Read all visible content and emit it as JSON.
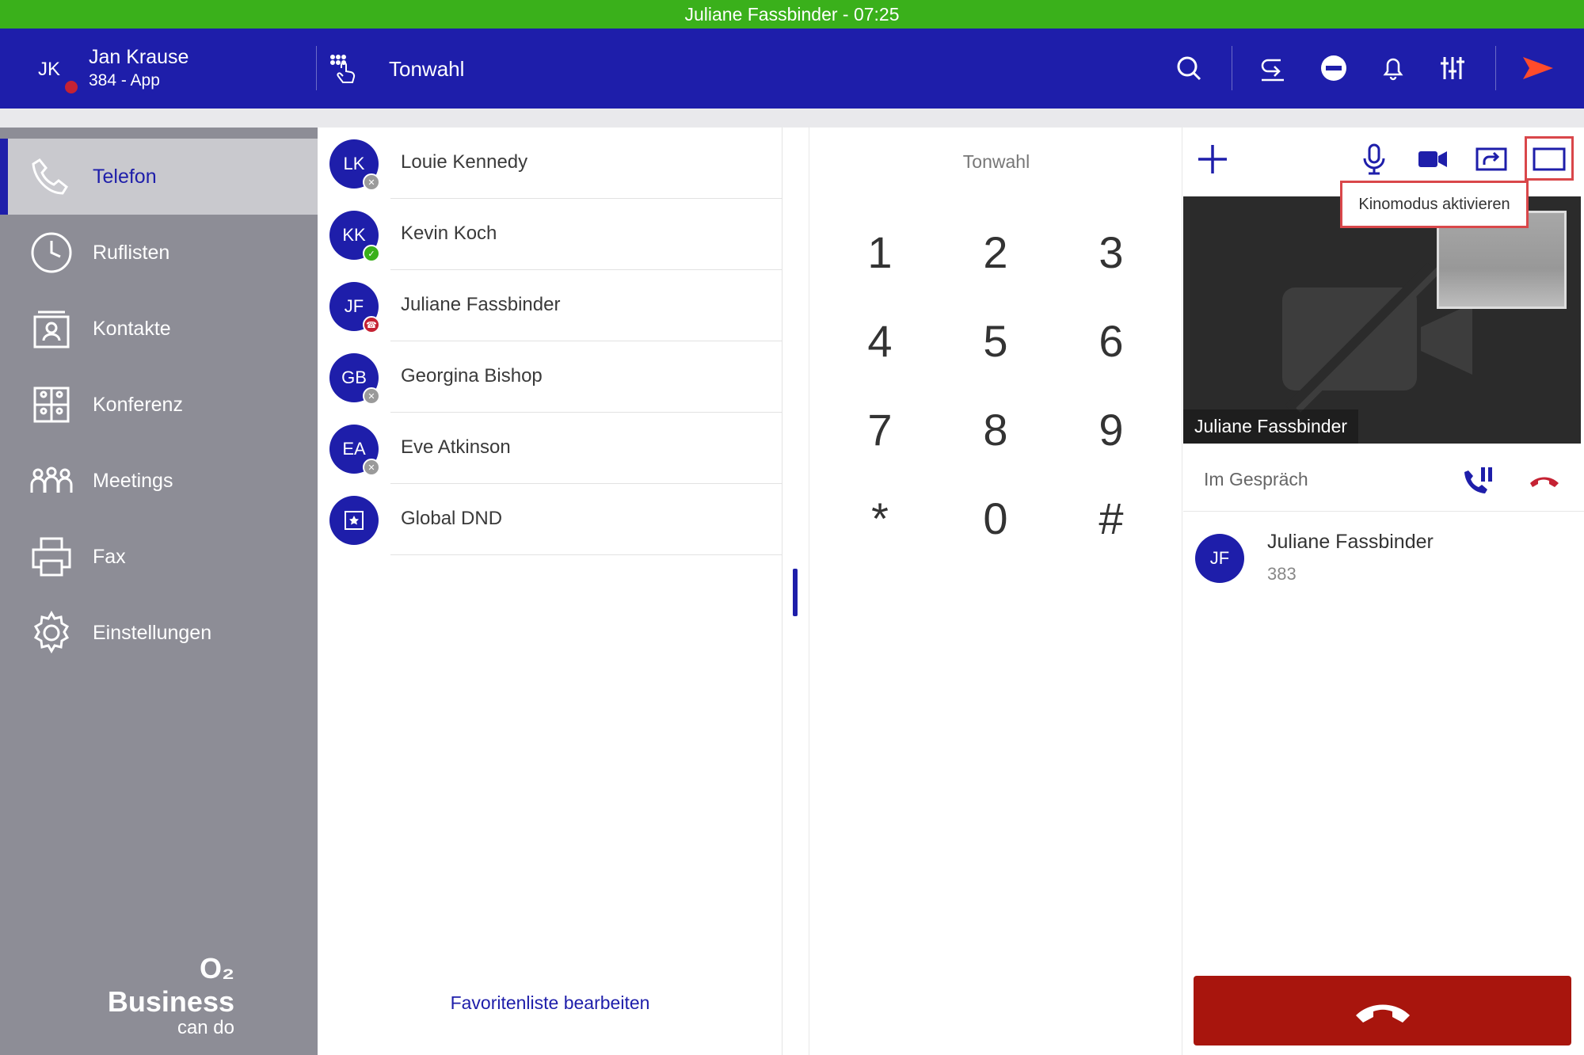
{
  "callbar": {
    "text": "Juliane Fassbinder - 07:25"
  },
  "header": {
    "user_initials": "JK",
    "user_name": "Jan Krause",
    "user_ext": "384 - App",
    "title": "Tonwahl"
  },
  "sidebar": {
    "items": [
      {
        "label": "Telefon",
        "icon": "phone-icon"
      },
      {
        "label": "Ruflisten",
        "icon": "clock-icon"
      },
      {
        "label": "Kontakte",
        "icon": "contacts-icon"
      },
      {
        "label": "Konferenz",
        "icon": "conference-icon"
      },
      {
        "label": "Meetings",
        "icon": "meetings-icon"
      },
      {
        "label": "Fax",
        "icon": "fax-icon"
      },
      {
        "label": "Einstellungen",
        "icon": "settings-icon"
      }
    ],
    "brand_line1": "O₂ Business",
    "brand_line2": "can do"
  },
  "favorites": {
    "items": [
      {
        "initials": "LK",
        "name": "Louie Kennedy",
        "status": "offline"
      },
      {
        "initials": "KK",
        "name": "Kevin Koch",
        "status": "available"
      },
      {
        "initials": "JF",
        "name": "Juliane Fassbinder",
        "status": "on-call"
      },
      {
        "initials": "GB",
        "name": "Georgina Bishop",
        "status": "offline"
      },
      {
        "initials": "EA",
        "name": "Eve Atkinson",
        "status": "offline"
      },
      {
        "initials": "",
        "name": "Global DND",
        "status": "none"
      }
    ],
    "edit_label": "Favoritenliste bearbeiten"
  },
  "keypad": {
    "title": "Tonwahl",
    "keys": [
      "1",
      "2",
      "3",
      "4",
      "5",
      "6",
      "7",
      "8",
      "9",
      "*",
      "0",
      "#"
    ]
  },
  "call": {
    "tooltip": "Kinomodus aktivieren",
    "video_label": "Juliane Fassbinder",
    "status": "Im Gespräch",
    "participant_initials": "JF",
    "participant_name": "Juliane Fassbinder",
    "participant_number": "383"
  },
  "colors": {
    "primary": "#1e1eaa",
    "callbar": "#3ab01b",
    "sidebar": "#8d8d96",
    "hangup": "#a8150d",
    "available": "#3ab01b",
    "busy": "#c52233",
    "offline": "#9a9a9a",
    "highlight": "#d9474a"
  }
}
